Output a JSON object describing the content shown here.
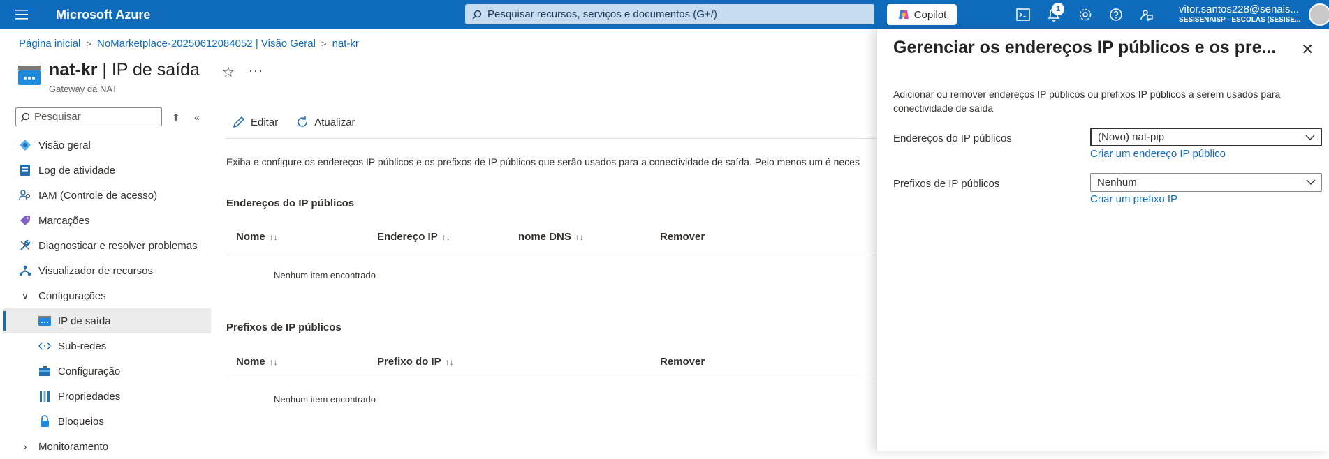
{
  "topbar": {
    "brand": "Microsoft Azure",
    "search_placeholder": "Pesquisar recursos, serviços e documentos (G+/)",
    "copilot_label": "Copilot",
    "notification_count": "1",
    "account_name": "vitor.santos228@senais...",
    "account_org": "SESISENAISP - ESCOLAS (SESISE..."
  },
  "breadcrumb": {
    "home": "Página inicial",
    "parent": "NoMarketplace-20250612084052 | Visão Geral",
    "current": "nat-kr"
  },
  "header": {
    "resource_name": "nat-kr",
    "separator": " | ",
    "page_name": "IP de saída",
    "subtitle": "Gateway da NAT",
    "more": "···"
  },
  "sidebar": {
    "search_placeholder": "Pesquisar",
    "items": [
      {
        "label": "Visão geral",
        "icon": "overview-icon"
      },
      {
        "label": "Log de atividade",
        "icon": "activity-log-icon"
      },
      {
        "label": "IAM (Controle de acesso)",
        "icon": "iam-icon"
      },
      {
        "label": "Marcações",
        "icon": "tag-icon"
      },
      {
        "label": "Diagnosticar e resolver problemas",
        "icon": "wrench-icon"
      },
      {
        "label": "Visualizador de recursos",
        "icon": "resource-visualizer-icon"
      },
      {
        "label": "Configurações",
        "icon": "chevron-down-icon"
      },
      {
        "label": "IP de saída",
        "icon": "outbound-ip-icon"
      },
      {
        "label": "Sub-redes",
        "icon": "subnet-icon"
      },
      {
        "label": "Configuração",
        "icon": "configuration-icon"
      },
      {
        "label": "Propriedades",
        "icon": "properties-icon"
      },
      {
        "label": "Bloqueios",
        "icon": "lock-icon"
      },
      {
        "label": "Monitoramento",
        "icon": "chevron-right-icon"
      }
    ]
  },
  "toolbar": {
    "edit": "Editar",
    "refresh": "Atualizar"
  },
  "main": {
    "description": "Exiba e configure os endereços IP públicos e os prefixos de IP públicos que serão usados para a conectividade de saída. Pelo menos um é neces",
    "ip_section": {
      "title": "Endereços do IP públicos",
      "columns": [
        "Nome",
        "Endereço IP",
        "nome DNS",
        "Remover"
      ],
      "empty": "Nenhum item encontrado"
    },
    "prefix_section": {
      "title": "Prefixos de IP públicos",
      "columns": [
        "Nome",
        "Prefixo do IP",
        "Remover"
      ],
      "empty": "Nenhum item encontrado"
    }
  },
  "panel": {
    "title": "Gerenciar os endereços IP públicos e os pre...",
    "description": "Adicionar ou remover endereços IP públicos ou prefixos IP públicos a serem usados para conectividade de saída",
    "ip_label": "Endereços do IP públicos",
    "ip_value": "(Novo) nat-pip",
    "ip_link": "Criar um endereço IP público",
    "prefix_label": "Prefixos de IP públicos",
    "prefix_value": "Nenhum",
    "prefix_link": "Criar um prefixo IP"
  },
  "colors": {
    "topbar": "#0f6cbd",
    "link": "#0f6cbd",
    "active_nav": "#ebebeb"
  }
}
